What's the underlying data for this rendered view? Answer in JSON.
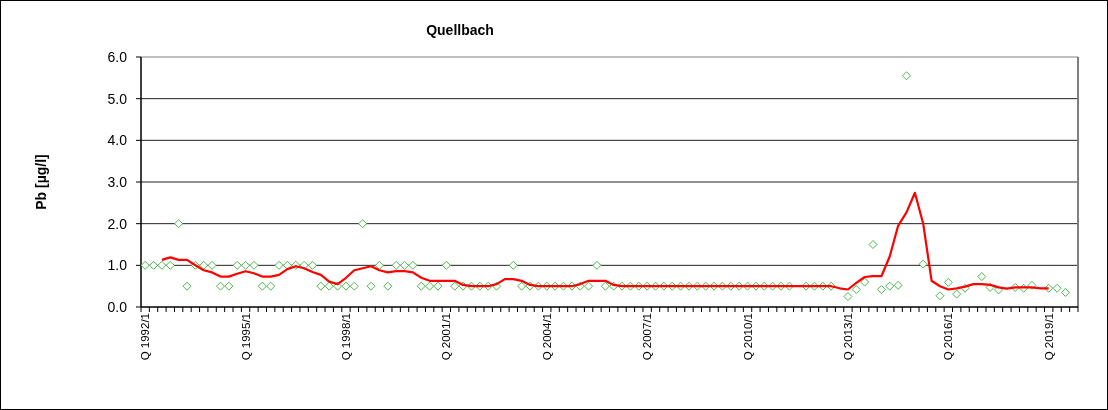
{
  "chart_data": {
    "type": "scatter",
    "title": "Quellbach",
    "ylabel": "Pb [µg/l]",
    "categories": [
      "Q 1992/1",
      null,
      null,
      null,
      null,
      null,
      null,
      null,
      null,
      null,
      null,
      null,
      "Q 1995/1",
      null,
      null,
      null,
      null,
      null,
      null,
      null,
      null,
      null,
      null,
      null,
      "Q 1998/1",
      null,
      null,
      null,
      null,
      null,
      null,
      null,
      null,
      null,
      null,
      null,
      "Q 2001/1",
      null,
      null,
      null,
      null,
      null,
      null,
      null,
      null,
      null,
      null,
      null,
      "Q 2004/1",
      null,
      null,
      null,
      null,
      null,
      null,
      null,
      null,
      null,
      null,
      null,
      "Q 2007/1",
      null,
      null,
      null,
      null,
      null,
      null,
      null,
      null,
      null,
      null,
      null,
      "Q 2010/1",
      null,
      null,
      null,
      null,
      null,
      null,
      null,
      null,
      null,
      null,
      null,
      "Q 2013/1",
      null,
      null,
      null,
      null,
      null,
      null,
      null,
      null,
      null,
      null,
      null,
      "Q 2016/1",
      null,
      null,
      null,
      null,
      null,
      null,
      null,
      null,
      null,
      null,
      null,
      "Q 2019/1",
      null,
      null,
      null
    ],
    "ylim": [
      0,
      6
    ],
    "grid": true,
    "yticks": [
      {
        "value": 0,
        "label": "0.0"
      },
      {
        "value": 1,
        "label": "1.0"
      },
      {
        "value": 2,
        "label": "2.0"
      },
      {
        "value": 3,
        "label": "3.0"
      },
      {
        "value": 4,
        "label": "4.0"
      },
      {
        "value": 5,
        "label": "5.0"
      },
      {
        "value": 6,
        "label": "6.0"
      }
    ],
    "series": [
      {
        "type": "scatter",
        "color": "#4cb84c",
        "values": [
          1,
          1,
          1,
          1,
          2,
          0.5,
          1,
          1,
          1,
          0.5,
          0.5,
          1,
          1,
          1,
          0.5,
          0.5,
          1,
          1,
          1,
          1,
          1,
          0.5,
          0.5,
          0.5,
          0.5,
          0.5,
          2,
          0.5,
          1,
          0.5,
          1,
          1,
          1,
          0.5,
          0.5,
          0.5,
          1,
          0.5,
          0.5,
          0.5,
          0.5,
          0.5,
          0.5,
          null,
          1,
          0.5,
          0.5,
          0.5,
          0.5,
          0.5,
          0.5,
          0.5,
          0.5,
          0.5,
          1,
          0.5,
          0.5,
          0.5,
          0.5,
          0.5,
          0.5,
          0.5,
          0.5,
          0.5,
          0.5,
          0.5,
          0.5,
          0.5,
          0.5,
          0.5,
          0.5,
          0.5,
          0.5,
          0.5,
          0.5,
          0.5,
          0.5,
          0.5,
          null,
          0.5,
          0.5,
          0.5,
          0.5,
          null,
          0.25,
          0.42,
          0.6,
          1.5,
          0.42,
          0.5,
          0.52,
          5.55,
          null,
          1.03,
          null,
          0.27,
          0.59,
          0.31,
          0.45,
          null,
          0.73,
          0.47,
          0.41,
          null,
          0.47,
          0.45,
          0.52,
          null,
          0.45,
          0.45,
          0.35,
          null
        ]
      },
      {
        "type": "line",
        "color": "#ff0000",
        "values": [
          null,
          null,
          1.13,
          1.19,
          1.13,
          1.13,
          1.0,
          0.88,
          0.83,
          0.73,
          0.73,
          0.8,
          0.86,
          0.81,
          0.73,
          0.73,
          0.77,
          0.91,
          0.98,
          0.93,
          0.84,
          0.77,
          0.61,
          0.55,
          0.7,
          0.88,
          0.93,
          0.98,
          0.88,
          0.83,
          0.86,
          0.86,
          0.83,
          0.7,
          0.63,
          0.63,
          0.63,
          0.63,
          0.53,
          0.5,
          0.5,
          0.5,
          0.55,
          0.67,
          0.67,
          0.63,
          0.53,
          0.5,
          0.5,
          0.5,
          0.5,
          0.5,
          0.55,
          0.63,
          0.63,
          0.63,
          0.53,
          0.5,
          0.5,
          0.5,
          0.5,
          0.5,
          0.5,
          0.5,
          0.5,
          0.5,
          0.5,
          0.5,
          0.5,
          0.5,
          0.5,
          0.5,
          0.5,
          0.5,
          0.5,
          0.5,
          0.5,
          0.5,
          0.5,
          0.5,
          0.5,
          0.5,
          0.5,
          0.45,
          0.42,
          0.58,
          0.72,
          0.74,
          0.74,
          1.22,
          1.95,
          2.27,
          2.74,
          2.0,
          0.63,
          0.5,
          0.42,
          0.45,
          0.49,
          0.55,
          0.55,
          0.53,
          0.47,
          0.44,
          0.47,
          0.47,
          0.47,
          0.45,
          0.45,
          null,
          null,
          null
        ]
      }
    ]
  }
}
